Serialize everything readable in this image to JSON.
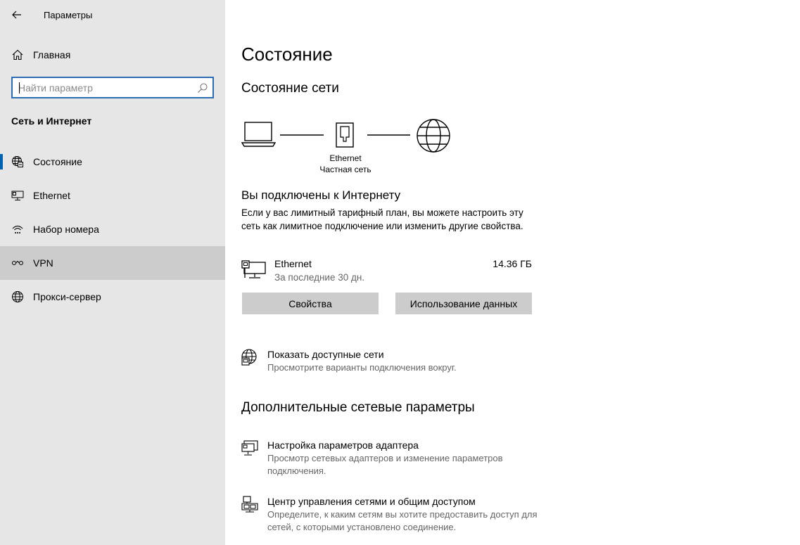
{
  "app": {
    "title": "Параметры"
  },
  "sidebar": {
    "home_label": "Главная",
    "search_placeholder": "Найти параметр",
    "section_title": "Сеть и Интернет",
    "items": [
      {
        "label": "Состояние",
        "icon": "globe-status-icon",
        "active": true
      },
      {
        "label": "Ethernet",
        "icon": "ethernet-icon",
        "active": false
      },
      {
        "label": "Набор номера",
        "icon": "dialup-icon",
        "active": false
      },
      {
        "label": "VPN",
        "icon": "vpn-icon",
        "active": false,
        "hover": true
      },
      {
        "label": "Прокси-сервер",
        "icon": "globe-icon",
        "active": false
      }
    ]
  },
  "main": {
    "title": "Состояние",
    "network_status_title": "Состояние сети",
    "diagram": {
      "adapter_name": "Ethernet",
      "network_type": "Частная сеть"
    },
    "connected_title": "Вы подключены к Интернету",
    "connected_desc": "Если у вас лимитный тарифный план, вы можете настроить эту сеть как лимитное подключение или изменить другие свойства.",
    "connection": {
      "name": "Ethernet",
      "period": "За последние 30 дн.",
      "usage": "14.36 ГБ"
    },
    "buttons": {
      "properties": "Свойства",
      "data_usage": "Использование данных"
    },
    "show_networks": {
      "title": "Показать доступные сети",
      "desc": "Просмотрите варианты подключения вокруг."
    },
    "advanced_title": "Дополнительные сетевые параметры",
    "adapter_settings": {
      "title": "Настройка параметров адаптера",
      "desc": "Просмотр сетевых адаптеров и изменение параметров подключения."
    },
    "sharing_center": {
      "title": "Центр управления сетями и общим доступом",
      "desc": "Определите, к каким сетям вы хотите предоставить доступ для сетей, с которыми установлено соединение."
    }
  },
  "colors": {
    "sidebar_bg": "#e6e6e6",
    "accent": "#0063b1",
    "search_border": "#2b6cb3",
    "button_bg": "#cccccc",
    "secondary_text": "#666666"
  }
}
